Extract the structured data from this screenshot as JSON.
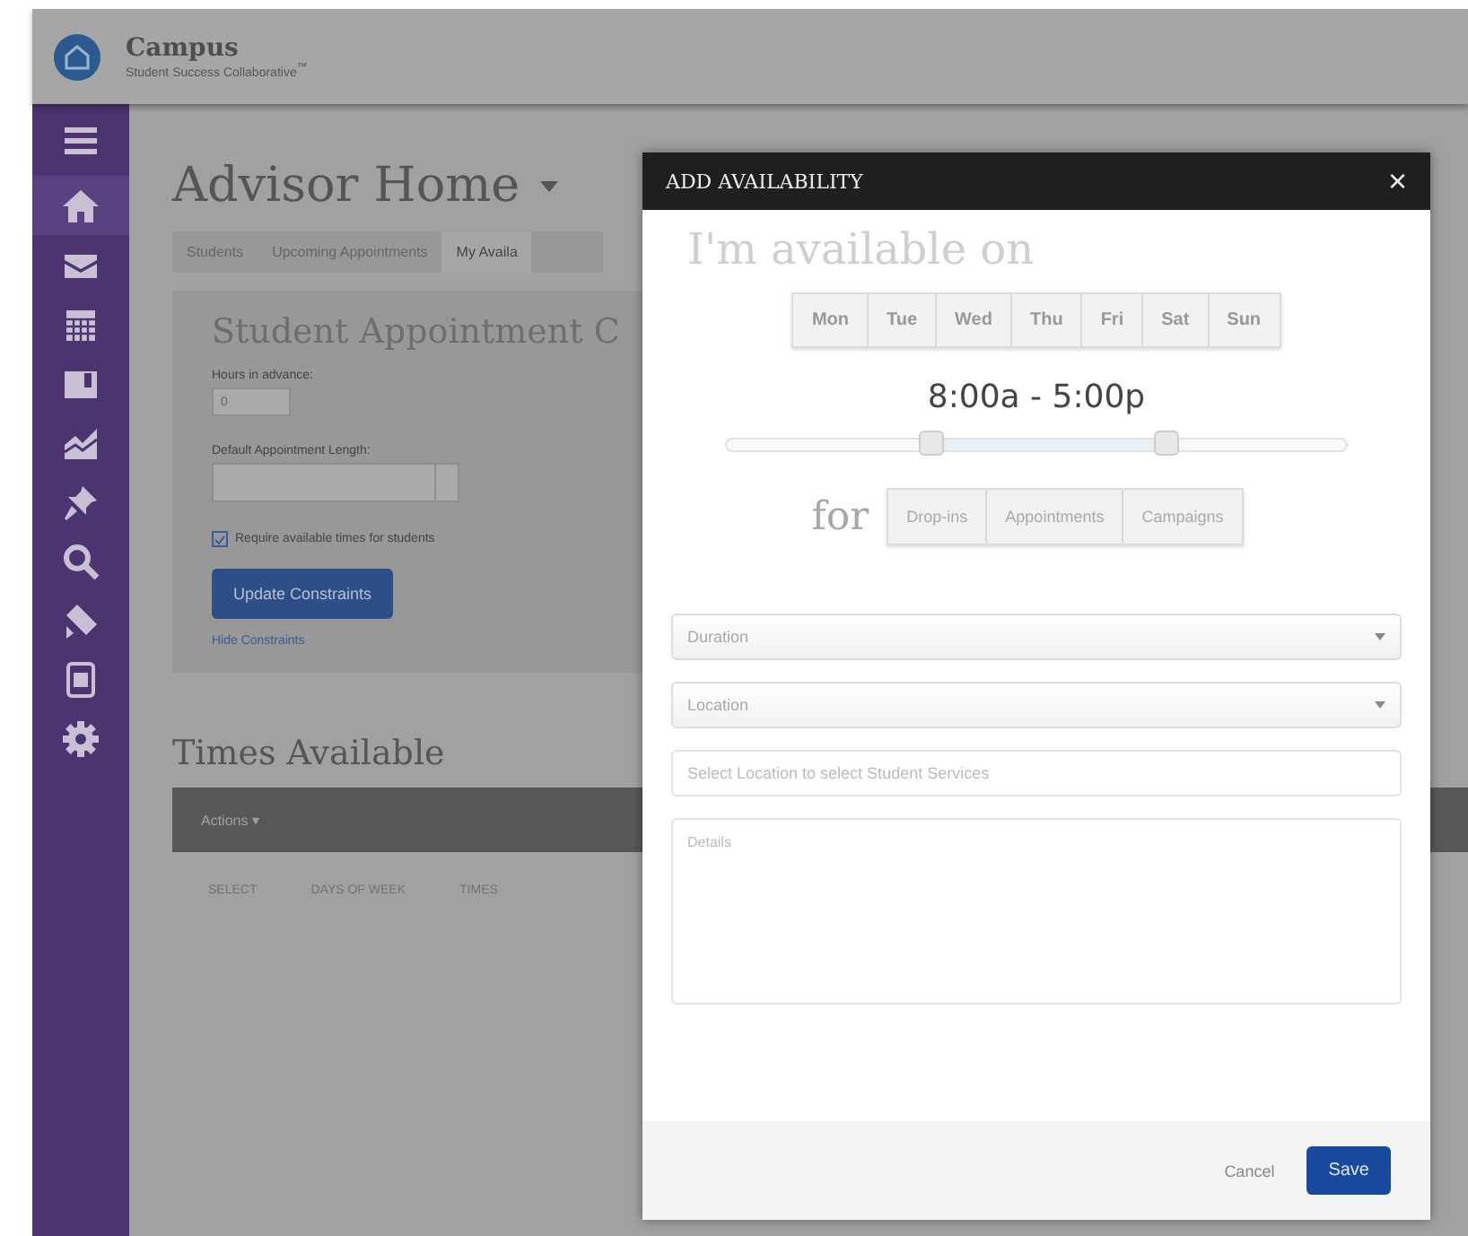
{
  "header": {
    "app_name": "Campus",
    "app_subtitle": "Student Success Collaborative$^{™}$"
  },
  "sidebar": {
    "items": [
      {
        "kind": "menu",
        "selected": false
      },
      {
        "kind": "home",
        "selected": true
      },
      {
        "kind": "mail",
        "selected": false
      },
      {
        "kind": "calendar",
        "selected": false
      },
      {
        "kind": "book",
        "selected": false
      },
      {
        "kind": "chart",
        "selected": false
      },
      {
        "kind": "pin",
        "selected": false
      },
      {
        "kind": "search",
        "selected": false
      },
      {
        "kind": "tag",
        "selected": false
      },
      {
        "kind": "document",
        "selected": false
      },
      {
        "kind": "settings",
        "selected": false
      }
    ]
  },
  "page": {
    "title": "Advisor Home",
    "tabs": [
      {
        "label": "Students",
        "selected": false
      },
      {
        "label": "Upcoming Appointments",
        "selected": false
      },
      {
        "label": "My Availa",
        "selected": true
      }
    ],
    "constraints": {
      "title": "Student Appointment C",
      "hours_label": "Hours in advance:",
      "hours_value": "0",
      "length_label": "Default Appointment Length:",
      "require_label": "Require available times for students",
      "require_checked": true,
      "update_button": "Update Constraints",
      "hide_link": "Hide Constraints"
    },
    "times": {
      "title": "Times Available",
      "actions": "Actions ▾",
      "columns": [
        "SELECT",
        "DAYS OF WEEK",
        "TIMES"
      ]
    }
  },
  "modal": {
    "title": "ADD AVAILABILITY",
    "close": "×",
    "heading": "I'm available on",
    "days": [
      {
        "label": "Mon",
        "selected": false
      },
      {
        "label": "Tue",
        "selected": false
      },
      {
        "label": "Wed",
        "selected": false
      },
      {
        "label": "Thu",
        "selected": false
      },
      {
        "label": "Fri",
        "selected": false
      },
      {
        "label": "Sat",
        "selected": false
      },
      {
        "label": "Sun",
        "selected": false
      }
    ],
    "time_range": "8:00a - 5:00p",
    "thumbs": [
      {
        "level": 0.33
      },
      {
        "level": 0.71
      }
    ],
    "for_label": "for",
    "types": [
      {
        "label": "Drop-ins",
        "selected": false
      },
      {
        "label": "Appointments",
        "selected": false
      },
      {
        "label": "Campaigns",
        "selected": false
      }
    ],
    "duration": {
      "placeholder": "Duration"
    },
    "location": {
      "placeholder": "Location"
    },
    "services": {
      "placeholder": "Select Location to select Student Services"
    },
    "details": {
      "placeholder": "Details"
    },
    "cancel": "Cancel",
    "save": "Save"
  }
}
